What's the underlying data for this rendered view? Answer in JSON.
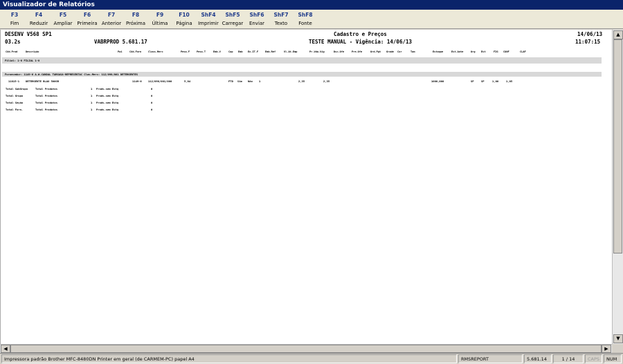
{
  "window": {
    "title": "Visualizador de Relatórios"
  },
  "toolbar": [
    {
      "key": "F3",
      "label": "Fim"
    },
    {
      "key": "F4",
      "label": "Reduzir"
    },
    {
      "key": "F5",
      "label": "Ampliar"
    },
    {
      "key": "F6",
      "label": "Primeira"
    },
    {
      "key": "F7",
      "label": "Anterior"
    },
    {
      "key": "F8",
      "label": "Próxima"
    },
    {
      "key": "F9",
      "label": "Última"
    },
    {
      "key": "F10",
      "label": "Página"
    },
    {
      "key": "ShF4",
      "label": "Imprimir"
    },
    {
      "key": "ShF5",
      "label": "Carregar"
    },
    {
      "key": "ShF6",
      "label": "Enviar"
    },
    {
      "key": "ShF7",
      "label": "Texto"
    },
    {
      "key": "ShF8",
      "label": "Fonte"
    }
  ],
  "report": {
    "system": "DESENV V568 SP1",
    "version_code": "03.2s",
    "program": "VABRPROD 5.681.17",
    "title": "Cadastro e Preços",
    "subtitle": "TESTE MANUAL - Vigência: 14/06/13",
    "date": "14/06/13",
    "time": "11:07:15",
    "columns": [
      "Cód.Prod",
      "Descrição",
      "Pai",
      "Cód.Forn",
      "Class.Merc",
      "Peso.F",
      "Peso.T",
      "Emb.V",
      "Cap",
      "Emb",
      "Ex.IT.F",
      "Emb.Ref",
      "Vl.At.Emp",
      "Pr.Vda.Vig",
      "Dsc.Ofe",
      "Pre.Ofe",
      "Ord.Pgt",
      "Grade",
      "Cor",
      "Tam",
      "Estoque",
      "Est.Ante",
      "Org",
      "Est",
      "FIG",
      "CONF",
      "CLAF"
    ],
    "filial_band": "Filial: 1-8  FILIAL 1-8",
    "fornecedor_band": "Fornecedor:      1149-6  A.W.CANDAL TARGASA-REPRESENTAC     Clas.Merc:   112/098/001  DETERGENTES",
    "item": {
      "code": "11815-1",
      "desc": "DETERGENTE BLAU 500GR",
      "forn": "1149-6",
      "class": "112/098/001/000",
      "peso": "5,84",
      "emb": "PTD",
      "sim": "Sim",
      "nao": "Não",
      "um": "1",
      "v1": "2,35",
      "v2": "2,35",
      "estoque": "1000,000",
      "org": "SP",
      "est": "SP",
      "fig": "1,00",
      "conf": "1,05"
    },
    "totals": [
      {
        "label": "Total SubGrupo",
        "sub": "Total Produtos",
        "n": "1",
        "desc": "Prods.sem Estq",
        "v": "0"
      },
      {
        "label": "Total Grupo",
        "sub": "Total Produtos",
        "n": "1",
        "desc": "Prods.sem Estq",
        "v": "0"
      },
      {
        "label": "Total Seção",
        "sub": "Total Produtos",
        "n": "1",
        "desc": "Prods.sem Estq",
        "v": "0"
      },
      {
        "label": "Total Forn.",
        "sub": "Total Produtos",
        "n": "1",
        "desc": "Prods.sem Estq",
        "v": "0"
      }
    ]
  },
  "status": {
    "printer": "Impressora padrão Brother MFC-8480DN Printer em geral (de CARMEM-PC) papel A4",
    "module": "RMSREPORT",
    "version": "5.681.14",
    "page": "1 / 14",
    "caps": "CAPS",
    "num": "NUM"
  }
}
